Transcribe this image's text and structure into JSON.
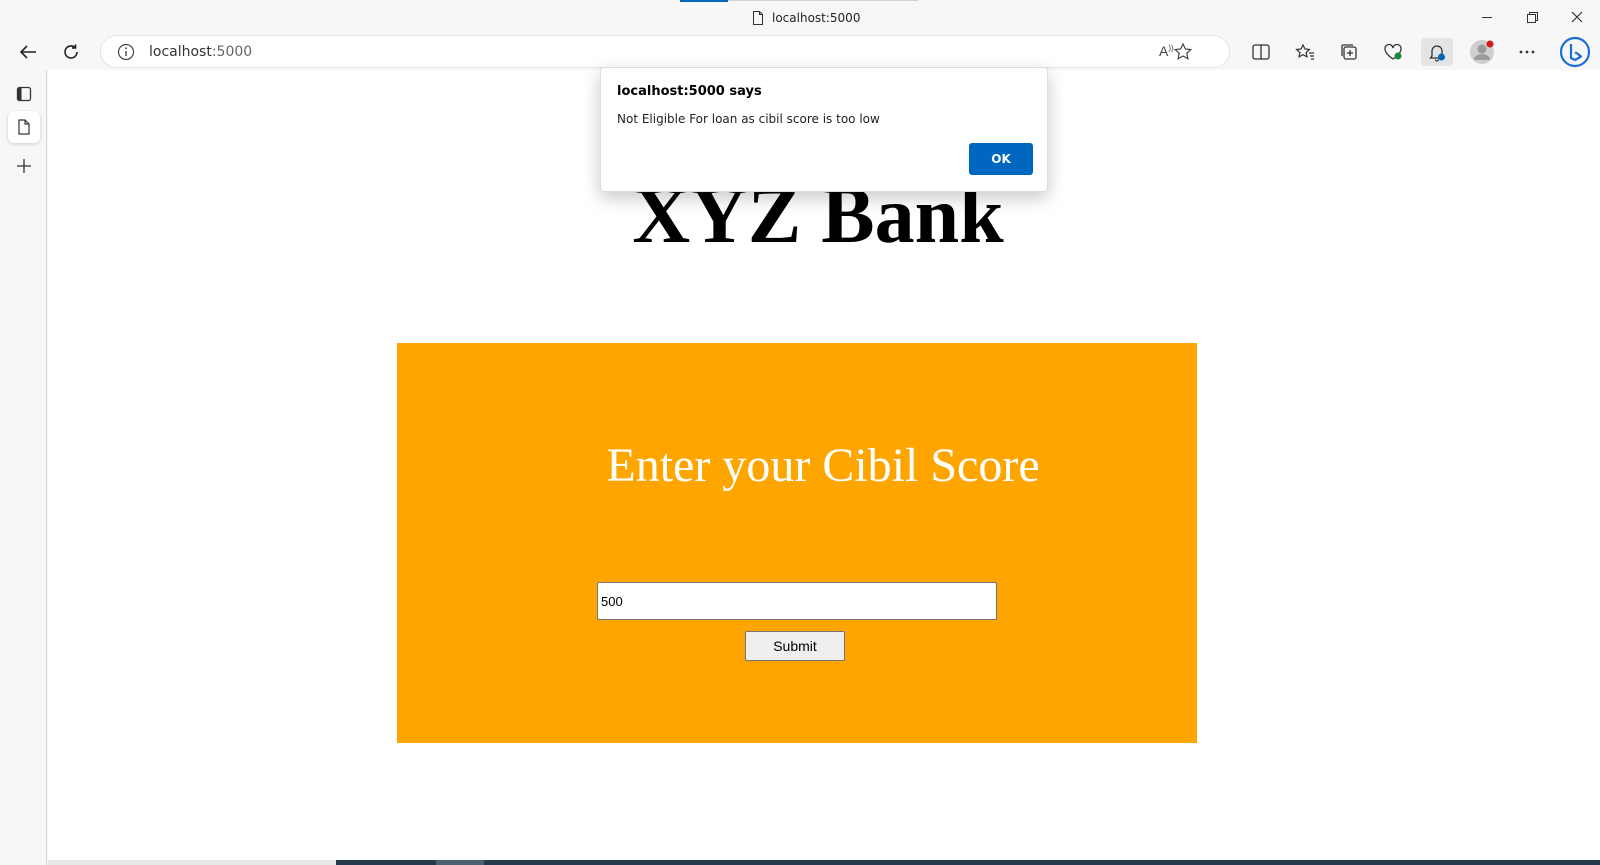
{
  "browser": {
    "tab_title": "localhost:5000",
    "url_host": "localhost",
    "url_port": ":5000",
    "read_aloud_label": "A",
    "accent_color": "#0067c0"
  },
  "page": {
    "bank_title": "XYZ Bank",
    "panel_heading": "Enter your Cibil Score",
    "panel_color": "#ffa500",
    "score_value": "500",
    "submit_label": "Submit"
  },
  "dialog": {
    "title": "localhost:5000 says",
    "message": "Not Eligible For loan as cibil score is too low",
    "ok_label": "OK"
  }
}
